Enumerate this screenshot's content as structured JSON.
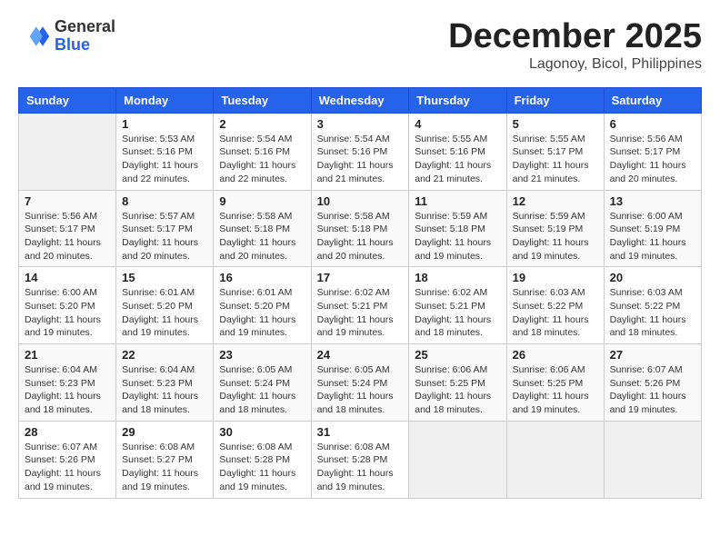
{
  "header": {
    "logo_general": "General",
    "logo_blue": "Blue",
    "month_title": "December 2025",
    "location": "Lagonoy, Bicol, Philippines"
  },
  "weekdays": [
    "Sunday",
    "Monday",
    "Tuesday",
    "Wednesday",
    "Thursday",
    "Friday",
    "Saturday"
  ],
  "weeks": [
    [
      {
        "day": "",
        "info": ""
      },
      {
        "day": "1",
        "info": "Sunrise: 5:53 AM\nSunset: 5:16 PM\nDaylight: 11 hours\nand 22 minutes."
      },
      {
        "day": "2",
        "info": "Sunrise: 5:54 AM\nSunset: 5:16 PM\nDaylight: 11 hours\nand 22 minutes."
      },
      {
        "day": "3",
        "info": "Sunrise: 5:54 AM\nSunset: 5:16 PM\nDaylight: 11 hours\nand 21 minutes."
      },
      {
        "day": "4",
        "info": "Sunrise: 5:55 AM\nSunset: 5:16 PM\nDaylight: 11 hours\nand 21 minutes."
      },
      {
        "day": "5",
        "info": "Sunrise: 5:55 AM\nSunset: 5:17 PM\nDaylight: 11 hours\nand 21 minutes."
      },
      {
        "day": "6",
        "info": "Sunrise: 5:56 AM\nSunset: 5:17 PM\nDaylight: 11 hours\nand 20 minutes."
      }
    ],
    [
      {
        "day": "7",
        "info": "Sunrise: 5:56 AM\nSunset: 5:17 PM\nDaylight: 11 hours\nand 20 minutes."
      },
      {
        "day": "8",
        "info": "Sunrise: 5:57 AM\nSunset: 5:17 PM\nDaylight: 11 hours\nand 20 minutes."
      },
      {
        "day": "9",
        "info": "Sunrise: 5:58 AM\nSunset: 5:18 PM\nDaylight: 11 hours\nand 20 minutes."
      },
      {
        "day": "10",
        "info": "Sunrise: 5:58 AM\nSunset: 5:18 PM\nDaylight: 11 hours\nand 20 minutes."
      },
      {
        "day": "11",
        "info": "Sunrise: 5:59 AM\nSunset: 5:18 PM\nDaylight: 11 hours\nand 19 minutes."
      },
      {
        "day": "12",
        "info": "Sunrise: 5:59 AM\nSunset: 5:19 PM\nDaylight: 11 hours\nand 19 minutes."
      },
      {
        "day": "13",
        "info": "Sunrise: 6:00 AM\nSunset: 5:19 PM\nDaylight: 11 hours\nand 19 minutes."
      }
    ],
    [
      {
        "day": "14",
        "info": "Sunrise: 6:00 AM\nSunset: 5:20 PM\nDaylight: 11 hours\nand 19 minutes."
      },
      {
        "day": "15",
        "info": "Sunrise: 6:01 AM\nSunset: 5:20 PM\nDaylight: 11 hours\nand 19 minutes."
      },
      {
        "day": "16",
        "info": "Sunrise: 6:01 AM\nSunset: 5:20 PM\nDaylight: 11 hours\nand 19 minutes."
      },
      {
        "day": "17",
        "info": "Sunrise: 6:02 AM\nSunset: 5:21 PM\nDaylight: 11 hours\nand 19 minutes."
      },
      {
        "day": "18",
        "info": "Sunrise: 6:02 AM\nSunset: 5:21 PM\nDaylight: 11 hours\nand 18 minutes."
      },
      {
        "day": "19",
        "info": "Sunrise: 6:03 AM\nSunset: 5:22 PM\nDaylight: 11 hours\nand 18 minutes."
      },
      {
        "day": "20",
        "info": "Sunrise: 6:03 AM\nSunset: 5:22 PM\nDaylight: 11 hours\nand 18 minutes."
      }
    ],
    [
      {
        "day": "21",
        "info": "Sunrise: 6:04 AM\nSunset: 5:23 PM\nDaylight: 11 hours\nand 18 minutes."
      },
      {
        "day": "22",
        "info": "Sunrise: 6:04 AM\nSunset: 5:23 PM\nDaylight: 11 hours\nand 18 minutes."
      },
      {
        "day": "23",
        "info": "Sunrise: 6:05 AM\nSunset: 5:24 PM\nDaylight: 11 hours\nand 18 minutes."
      },
      {
        "day": "24",
        "info": "Sunrise: 6:05 AM\nSunset: 5:24 PM\nDaylight: 11 hours\nand 18 minutes."
      },
      {
        "day": "25",
        "info": "Sunrise: 6:06 AM\nSunset: 5:25 PM\nDaylight: 11 hours\nand 18 minutes."
      },
      {
        "day": "26",
        "info": "Sunrise: 6:06 AM\nSunset: 5:25 PM\nDaylight: 11 hours\nand 19 minutes."
      },
      {
        "day": "27",
        "info": "Sunrise: 6:07 AM\nSunset: 5:26 PM\nDaylight: 11 hours\nand 19 minutes."
      }
    ],
    [
      {
        "day": "28",
        "info": "Sunrise: 6:07 AM\nSunset: 5:26 PM\nDaylight: 11 hours\nand 19 minutes."
      },
      {
        "day": "29",
        "info": "Sunrise: 6:08 AM\nSunset: 5:27 PM\nDaylight: 11 hours\nand 19 minutes."
      },
      {
        "day": "30",
        "info": "Sunrise: 6:08 AM\nSunset: 5:28 PM\nDaylight: 11 hours\nand 19 minutes."
      },
      {
        "day": "31",
        "info": "Sunrise: 6:08 AM\nSunset: 5:28 PM\nDaylight: 11 hours\nand 19 minutes."
      },
      {
        "day": "",
        "info": ""
      },
      {
        "day": "",
        "info": ""
      },
      {
        "day": "",
        "info": ""
      }
    ]
  ]
}
